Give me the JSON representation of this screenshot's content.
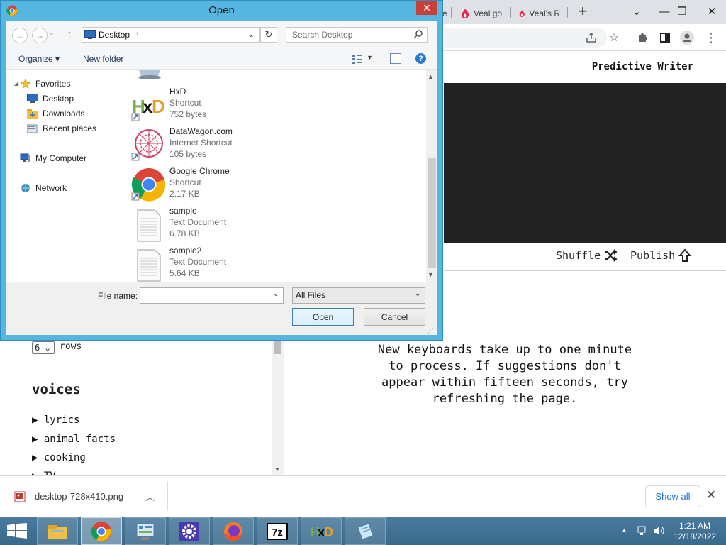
{
  "browser": {
    "tabs": [
      {
        "title": "e"
      },
      {
        "title": "Veal go"
      },
      {
        "title": "Veal's R"
      }
    ],
    "new_tab_label": "+",
    "window_controls": {
      "tab_search": "⌄",
      "minimize": "—",
      "restore": "❐",
      "close": "✕"
    },
    "toolbar_icons": [
      "share-icon",
      "star-icon",
      "puzzle-icon",
      "side-panel-icon",
      "profile-icon",
      "menu-icon"
    ]
  },
  "app": {
    "title": "Predictive Writer",
    "shuffle_label": "Shuffle",
    "publish_label": "Publish",
    "rows_value": "6",
    "rows_label": "rows",
    "voices_heading": "voices",
    "voices": [
      "lyrics",
      "animal facts",
      "cooking",
      "TV"
    ],
    "message": "New keyboards take up to one minute to process. If suggestions don't appear within fifteen seconds, try refreshing the page."
  },
  "download_shelf": {
    "file_name": "desktop-728x410.png",
    "show_all_label": "Show all"
  },
  "taskbar": {
    "time": "1:21 AM",
    "date": "12/18/2022",
    "apps": [
      "start",
      "file-explorer",
      "chrome",
      "control-panel",
      "settings",
      "firefox",
      "7zip",
      "hxd",
      "notepad"
    ]
  },
  "dialog": {
    "title": "Open",
    "address": "Desktop",
    "search_placeholder": "Search Desktop",
    "organize_label": "Organize",
    "new_folder_label": "New folder",
    "nav": {
      "favorites": "Favorites",
      "desktop": "Desktop",
      "downloads": "Downloads",
      "recent": "Recent places",
      "computer": "My Computer",
      "network": "Network"
    },
    "files": [
      {
        "name": "HxD",
        "type": "Shortcut",
        "size": "752 bytes"
      },
      {
        "name": "DataWagon.com",
        "type": "Internet Shortcut",
        "size": "105 bytes"
      },
      {
        "name": "Google Chrome",
        "type": "Shortcut",
        "size": "2.17 KB"
      },
      {
        "name": "sample",
        "type": "Text Document",
        "size": "6.78 KB"
      },
      {
        "name": "sample2",
        "type": "Text Document",
        "size": "5.64 KB"
      }
    ],
    "file_name_label": "File name:",
    "file_name_value": "",
    "filter": "All Files",
    "open_label": "Open",
    "cancel_label": "Cancel"
  },
  "colors": {
    "dialog_frame": "#57b6e0",
    "close_red": "#c7403a",
    "preview_bg": "#222222",
    "link_blue": "#1a73e8"
  }
}
